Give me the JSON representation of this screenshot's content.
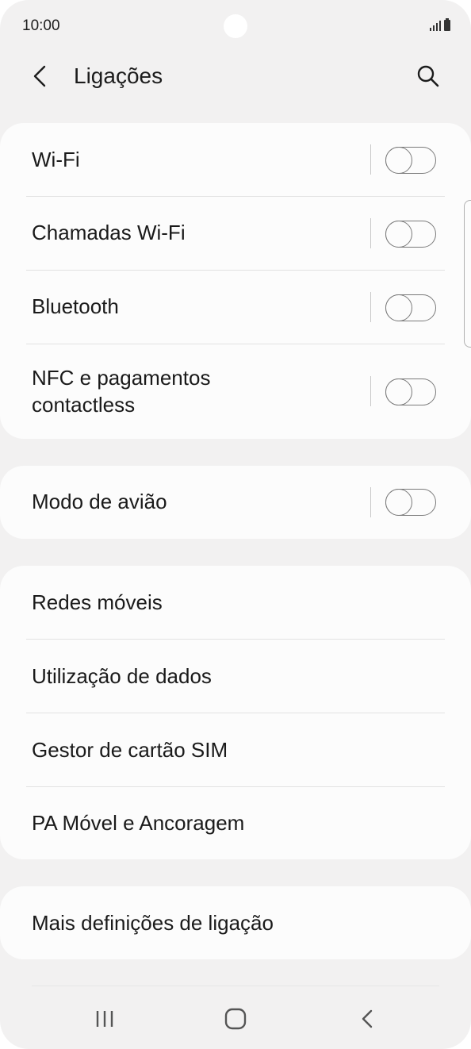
{
  "status_bar": {
    "time": "10:00"
  },
  "header": {
    "title": "Ligações",
    "back_icon": "chevron-left-icon",
    "search_icon": "search-icon"
  },
  "connectivity": {
    "items": [
      {
        "label": "Wi-Fi",
        "toggle": "off"
      },
      {
        "label": "Chamadas Wi-Fi",
        "toggle": "off"
      },
      {
        "label": "Bluetooth",
        "toggle": "off"
      },
      {
        "label_line1": "NFC e pagamentos",
        "label_line2": "contactless",
        "toggle": "off"
      }
    ]
  },
  "airplane": {
    "label": "Modo de avião",
    "toggle": "off"
  },
  "network": {
    "items": [
      {
        "label": "Redes móveis"
      },
      {
        "label": "Utilização de dados"
      },
      {
        "label": "Gestor de cartão SIM"
      },
      {
        "label": "PA Móvel e Ancoragem"
      }
    ]
  },
  "more": {
    "label": "Mais definições de ligação"
  },
  "nav_bar": {
    "recents_icon": "recent-apps-icon",
    "home_icon": "home-icon",
    "back_icon": "back-icon"
  },
  "colors": {
    "background": "#f2f1f1",
    "card": "#fcfcfc",
    "text": "#1a1a1a",
    "toggle_border": "#7a7a7a"
  }
}
